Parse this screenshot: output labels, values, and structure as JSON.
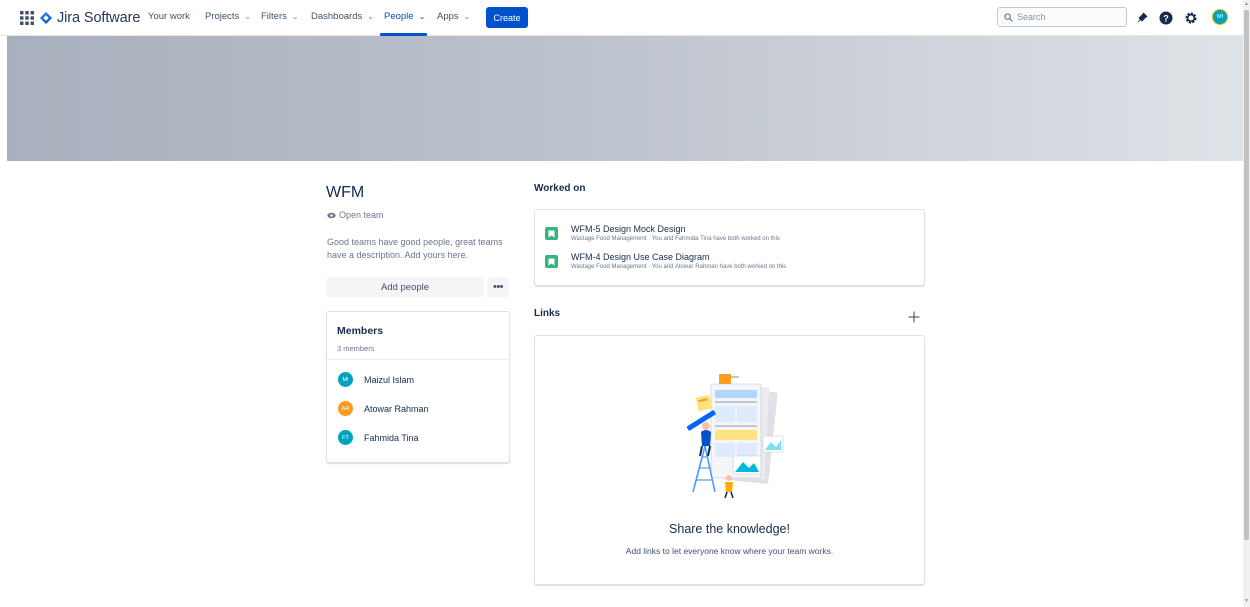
{
  "nav": {
    "product_name": "Jira Software",
    "items": [
      {
        "label": "Your work",
        "has_dropdown": false
      },
      {
        "label": "Projects",
        "has_dropdown": true
      },
      {
        "label": "Filters",
        "has_dropdown": true
      },
      {
        "label": "Dashboards",
        "has_dropdown": true
      },
      {
        "label": "People",
        "has_dropdown": true,
        "active": true
      },
      {
        "label": "Apps",
        "has_dropdown": true
      }
    ],
    "create_label": "Create",
    "search_placeholder": "Search",
    "icons": [
      "app-switcher-icon",
      "notifications-icon",
      "help-icon",
      "settings-icon"
    ],
    "user_avatar_initials": "MI"
  },
  "team": {
    "name": "WFM",
    "visibility": "Open team",
    "description": "Good teams have good people, great teams have a description. Add yours here.",
    "add_people_label": "Add people",
    "more_label": "•••"
  },
  "members": {
    "title": "Members",
    "count_label": "3 members",
    "list": [
      {
        "initials": "MI",
        "name": "Maizul Islam",
        "color": "#00a3bf"
      },
      {
        "initials": "AR",
        "name": "Atowar Rahman",
        "color": "#ff991f"
      },
      {
        "initials": "FT",
        "name": "Fahmida Tina",
        "color": "#00a3bf"
      }
    ]
  },
  "worked_on": {
    "title": "Worked on",
    "items": [
      {
        "title": "WFM-5 Design Mock Design",
        "subtitle": "Wastage Food Management · You and Fahmida Tina have both worked on this"
      },
      {
        "title": "WFM-4 Design Use Case Diagram",
        "subtitle": "Wastage Food Management · You and Atowar Rahman have both worked on this"
      }
    ]
  },
  "links": {
    "title": "Links",
    "empty_title": "Share the knowledge!",
    "empty_description": "Add links to let everyone know where your team works."
  },
  "colors": {
    "brand": "#0052cc",
    "story": "#36b37e",
    "text": "#172b4d",
    "subtle": "#6b778c"
  }
}
